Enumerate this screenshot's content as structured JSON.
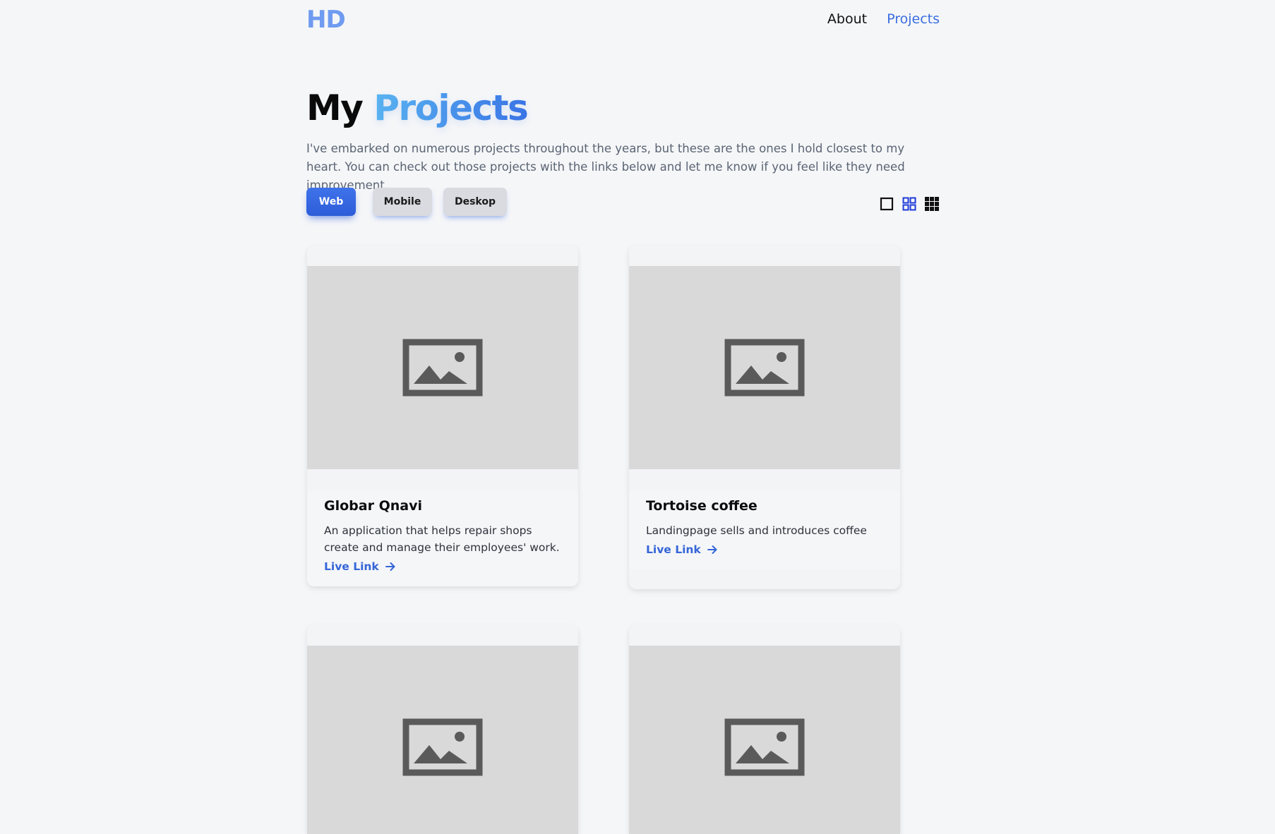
{
  "header": {
    "logo": "HD",
    "nav": [
      {
        "label": "About",
        "active": false
      },
      {
        "label": "Projects",
        "active": true
      }
    ]
  },
  "hero": {
    "title_plain": "My",
    "title_accent": "Projects",
    "description": "I've embarked on numerous projects throughout the years, but these are the ones I hold closest to my heart. You can check out those projects with the links below and let me know if you feel like they need improvement."
  },
  "filters": [
    {
      "label": "Web",
      "active": true
    },
    {
      "label": "Mobile",
      "active": false
    },
    {
      "label": "Deskop",
      "active": false
    }
  ],
  "view_toggles": [
    {
      "icon": "single-column-icon",
      "active": false
    },
    {
      "icon": "two-column-grid-icon",
      "active": true
    },
    {
      "icon": "three-column-grid-icon",
      "active": false
    }
  ],
  "projects": [
    {
      "title": "Globar Qnavi",
      "description": "An application that helps repair shops create and manage their employees' work.",
      "link_label": "Live Link"
    },
    {
      "title": "Tortoise coffee",
      "description": "Landingpage sells and introduces coffee",
      "link_label": "Live Link"
    },
    {
      "title": "",
      "description": "",
      "link_label": ""
    },
    {
      "title": "",
      "description": "",
      "link_label": ""
    }
  ],
  "colors": {
    "accent": "#3b6ee0",
    "logo": "#6f9bf0",
    "background": "#f5f6f8",
    "placeholder": "#d9d9d9",
    "placeholder_icon": "#5a5a5a"
  }
}
